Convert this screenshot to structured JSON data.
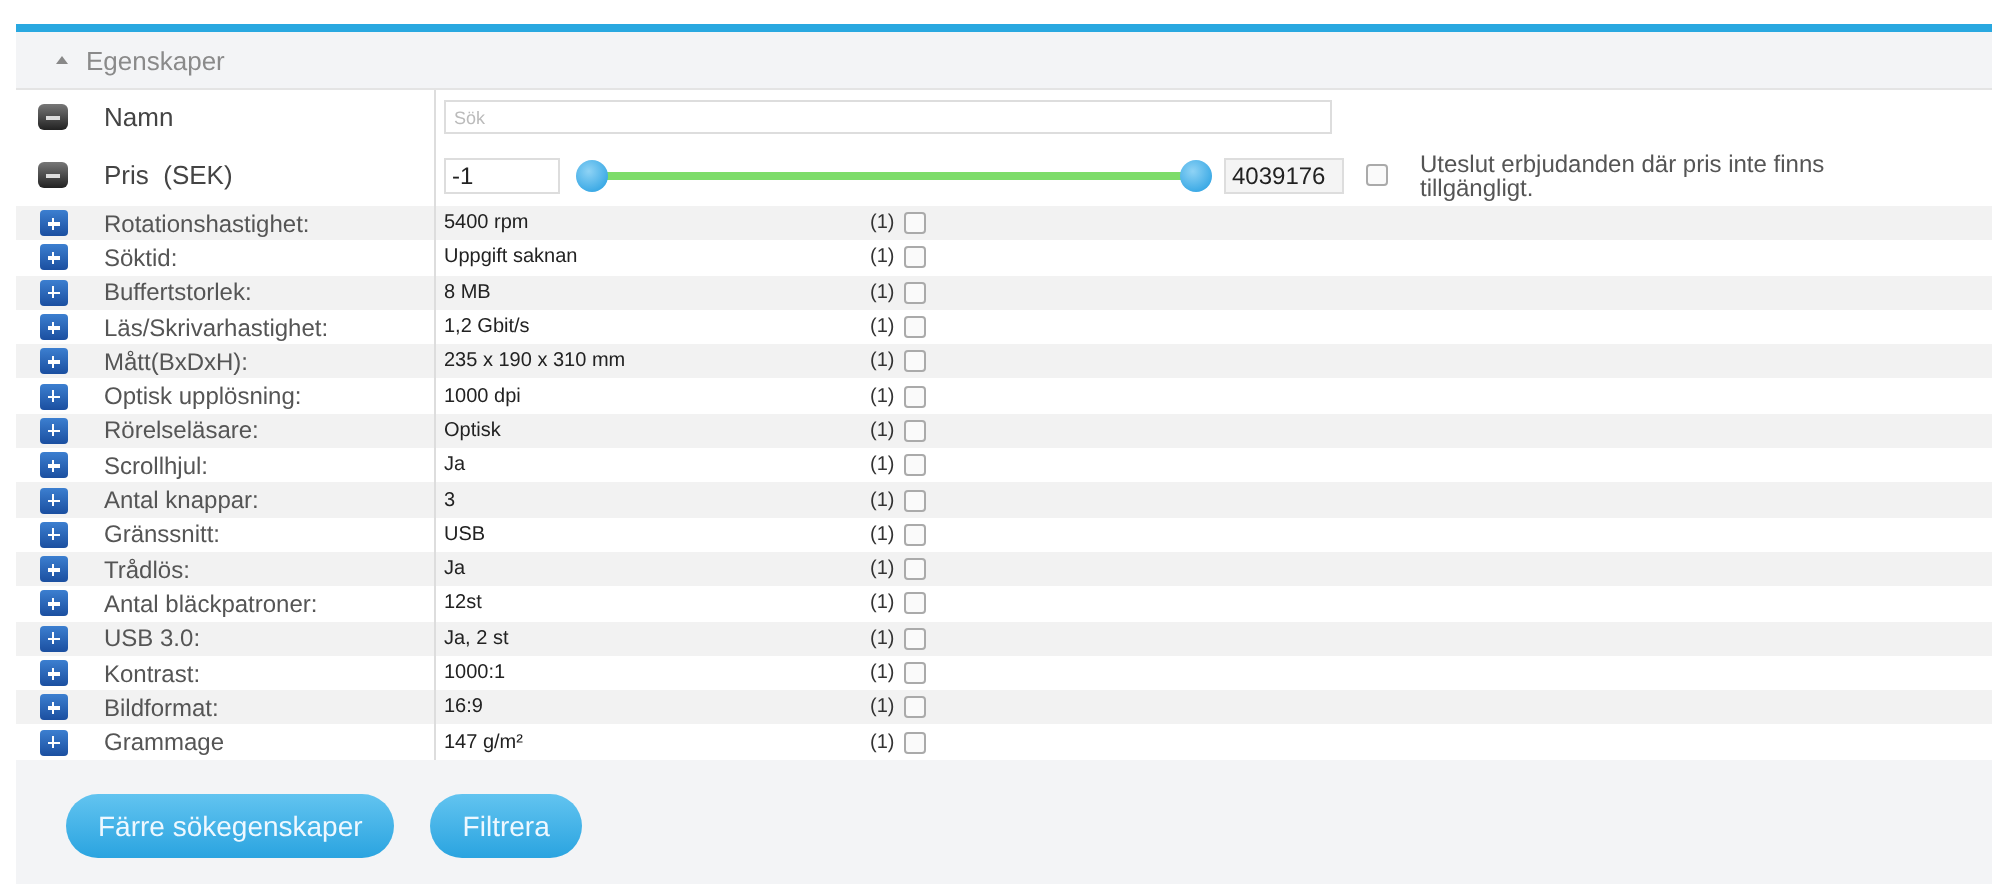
{
  "panel": {
    "title": "Egenskaper",
    "expanded": true
  },
  "filters": [
    {
      "kind": "text",
      "label": "Namn",
      "placeholder": "Sök"
    },
    {
      "kind": "range",
      "label": "Pris  (SEK)",
      "min": "-1",
      "max": "4039176",
      "thumbs": [
        {
          "level": 0
        },
        {
          "level": 1
        }
      ],
      "exclude": {
        "label": "Uteslut erbjudanden där pris inte finns tillgängligt.",
        "checked": false
      }
    }
  ],
  "properties": [
    {
      "label": "Rotationshastighet:",
      "value": "5400 rpm",
      "count": "(1)",
      "checked": false
    },
    {
      "label": "Söktid:",
      "value": "Uppgift saknan",
      "count": "(1)",
      "checked": false
    },
    {
      "label": "Buffertstorlek:",
      "value": "8 MB",
      "count": "(1)",
      "checked": false
    },
    {
      "label": "Läs/Skrivarhastighet:",
      "value": "1,2 Gbit/s",
      "count": "(1)",
      "checked": false
    },
    {
      "label": "Mått(BxDxH):",
      "value": "235 x 190 x 310 mm",
      "count": "(1)",
      "checked": false
    },
    {
      "label": "Optisk upplösning:",
      "value": "1000 dpi",
      "count": "(1)",
      "checked": false
    },
    {
      "label": "Rörelseläsare:",
      "value": "Optisk",
      "count": "(1)",
      "checked": false
    },
    {
      "label": "Scrollhjul:",
      "value": "Ja",
      "count": "(1)",
      "checked": false
    },
    {
      "label": "Antal knappar:",
      "value": "3",
      "count": "(1)",
      "checked": false
    },
    {
      "label": "Gränssnitt:",
      "value": "USB",
      "count": "(1)",
      "checked": false
    },
    {
      "label": "Trådlös:",
      "value": "Ja",
      "count": "(1)",
      "checked": false
    },
    {
      "label": "Antal bläckpatroner:",
      "value": "12st",
      "count": "(1)",
      "checked": false
    },
    {
      "label": "USB 3.0:",
      "value": "Ja, 2 st",
      "count": "(1)",
      "checked": false
    },
    {
      "label": "Kontrast:",
      "value": "1000:1",
      "count": "(1)",
      "checked": false
    },
    {
      "label": "Bildformat:",
      "value": "16:9",
      "count": "(1)",
      "checked": false
    },
    {
      "label": "Grammage",
      "value": "147 g/m²",
      "count": "(1)",
      "checked": false
    }
  ],
  "buttons": [
    "Färre sökegenskaper",
    "Filtrera"
  ]
}
